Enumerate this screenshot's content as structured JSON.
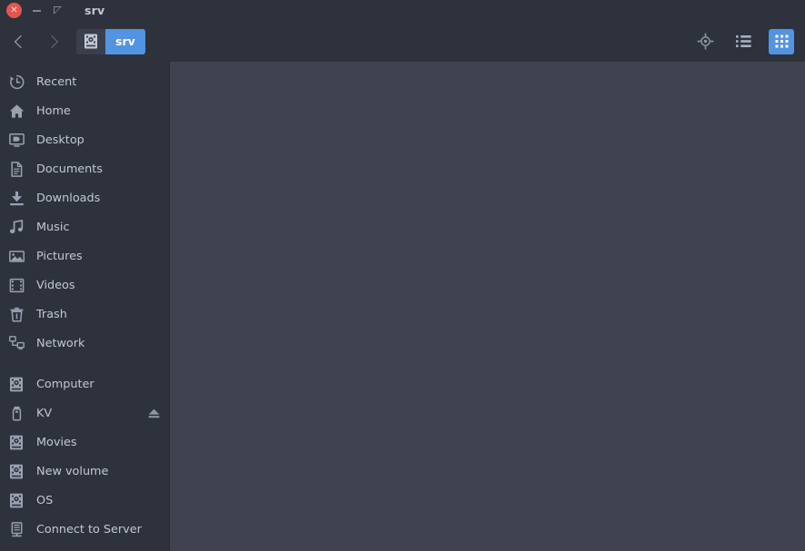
{
  "window": {
    "title": "srv",
    "controls": {
      "close": "close-window",
      "minimize": "minimize-window",
      "maximize": "maximize-window"
    }
  },
  "toolbar": {
    "back_label": "Back",
    "forward_label": "Forward",
    "breadcrumb": [
      {
        "label": "",
        "icon": "drive-icon",
        "active": false
      },
      {
        "label": "srv",
        "icon": "",
        "active": true
      }
    ],
    "buttons": [
      {
        "name": "location-icon",
        "label": "Location",
        "active": false
      },
      {
        "name": "list-view-icon",
        "label": "List View",
        "active": false
      },
      {
        "name": "grid-view-icon",
        "label": "Grid View",
        "active": true
      }
    ]
  },
  "sidebar": {
    "groups": [
      {
        "items": [
          {
            "label": "Recent",
            "icon": "clock-icon",
            "eject": false
          },
          {
            "label": "Home",
            "icon": "home-icon",
            "eject": false
          },
          {
            "label": "Desktop",
            "icon": "desktop-icon",
            "eject": false
          },
          {
            "label": "Documents",
            "icon": "document-icon",
            "eject": false
          },
          {
            "label": "Downloads",
            "icon": "download-icon",
            "eject": false
          },
          {
            "label": "Music",
            "icon": "music-icon",
            "eject": false
          },
          {
            "label": "Pictures",
            "icon": "picture-icon",
            "eject": false
          },
          {
            "label": "Videos",
            "icon": "video-icon",
            "eject": false
          },
          {
            "label": "Trash",
            "icon": "trash-icon",
            "eject": false
          },
          {
            "label": "Network",
            "icon": "network-icon",
            "eject": false
          }
        ]
      },
      {
        "items": [
          {
            "label": "Computer",
            "icon": "drive-icon",
            "eject": false
          },
          {
            "label": "KV",
            "icon": "usb-icon",
            "eject": true
          },
          {
            "label": "Movies",
            "icon": "drive-icon",
            "eject": false
          },
          {
            "label": "New volume",
            "icon": "drive-icon",
            "eject": false
          },
          {
            "label": "OS",
            "icon": "drive-icon",
            "eject": false
          },
          {
            "label": "Connect to Server",
            "icon": "server-icon",
            "eject": false
          }
        ]
      }
    ]
  },
  "main": {
    "empty": ""
  },
  "colors": {
    "chrome": "#2e323d",
    "content": "#3f434f",
    "accent": "#5294e2",
    "text": "#c2c8d6",
    "close": "#e0574f"
  }
}
